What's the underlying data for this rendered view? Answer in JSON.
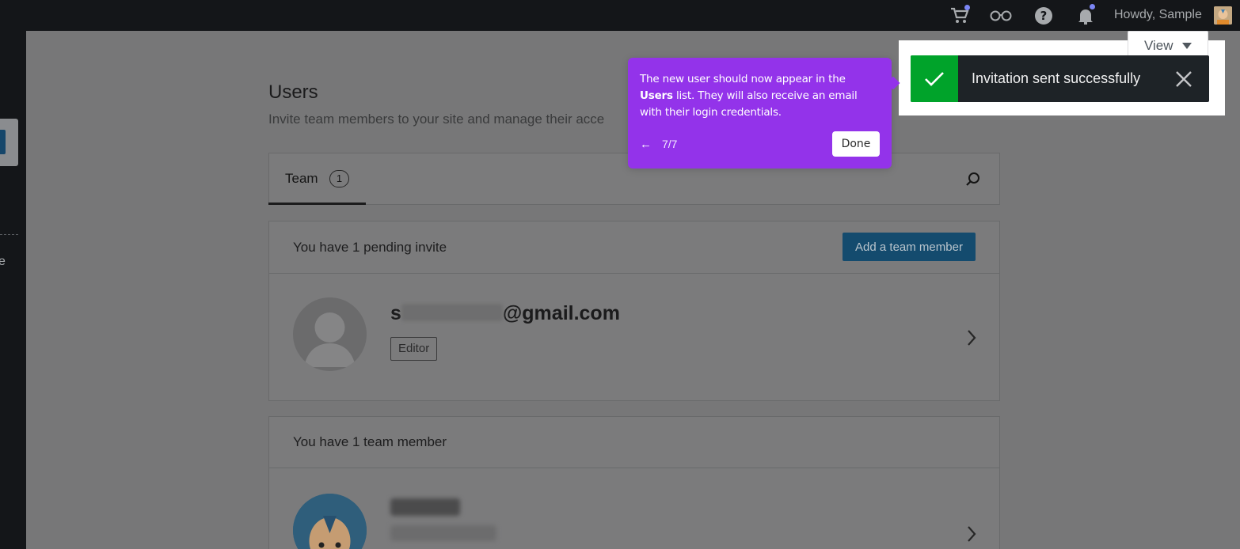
{
  "adminbar": {
    "greeting": "Howdy, Sample",
    "icons": [
      "cart-icon",
      "glasses-icon",
      "help-icon",
      "bell-icon"
    ]
  },
  "sidebar": {
    "partial_label": "e"
  },
  "page": {
    "title": "Users",
    "subtitle": "Invite team members to your site and manage their acce"
  },
  "tabs": {
    "team_label": "Team",
    "team_count": "1"
  },
  "pending": {
    "heading": "You have 1 pending invite",
    "add_button": "Add a team member",
    "email_prefix": "s",
    "email_suffix": "@gmail.com",
    "role": "Editor"
  },
  "team": {
    "heading": "You have 1 team member"
  },
  "view_button": "View",
  "snackbar": {
    "message": "Invitation sent successfully",
    "accent": "#00a32a"
  },
  "guide": {
    "text_before": "The new user should now appear in the ",
    "text_bold": "Users",
    "text_after": " list. They will also receive an email with their login credentials.",
    "step": "7/7",
    "back_icon": "←",
    "done_label": "Done",
    "accent": "#9333ea"
  }
}
